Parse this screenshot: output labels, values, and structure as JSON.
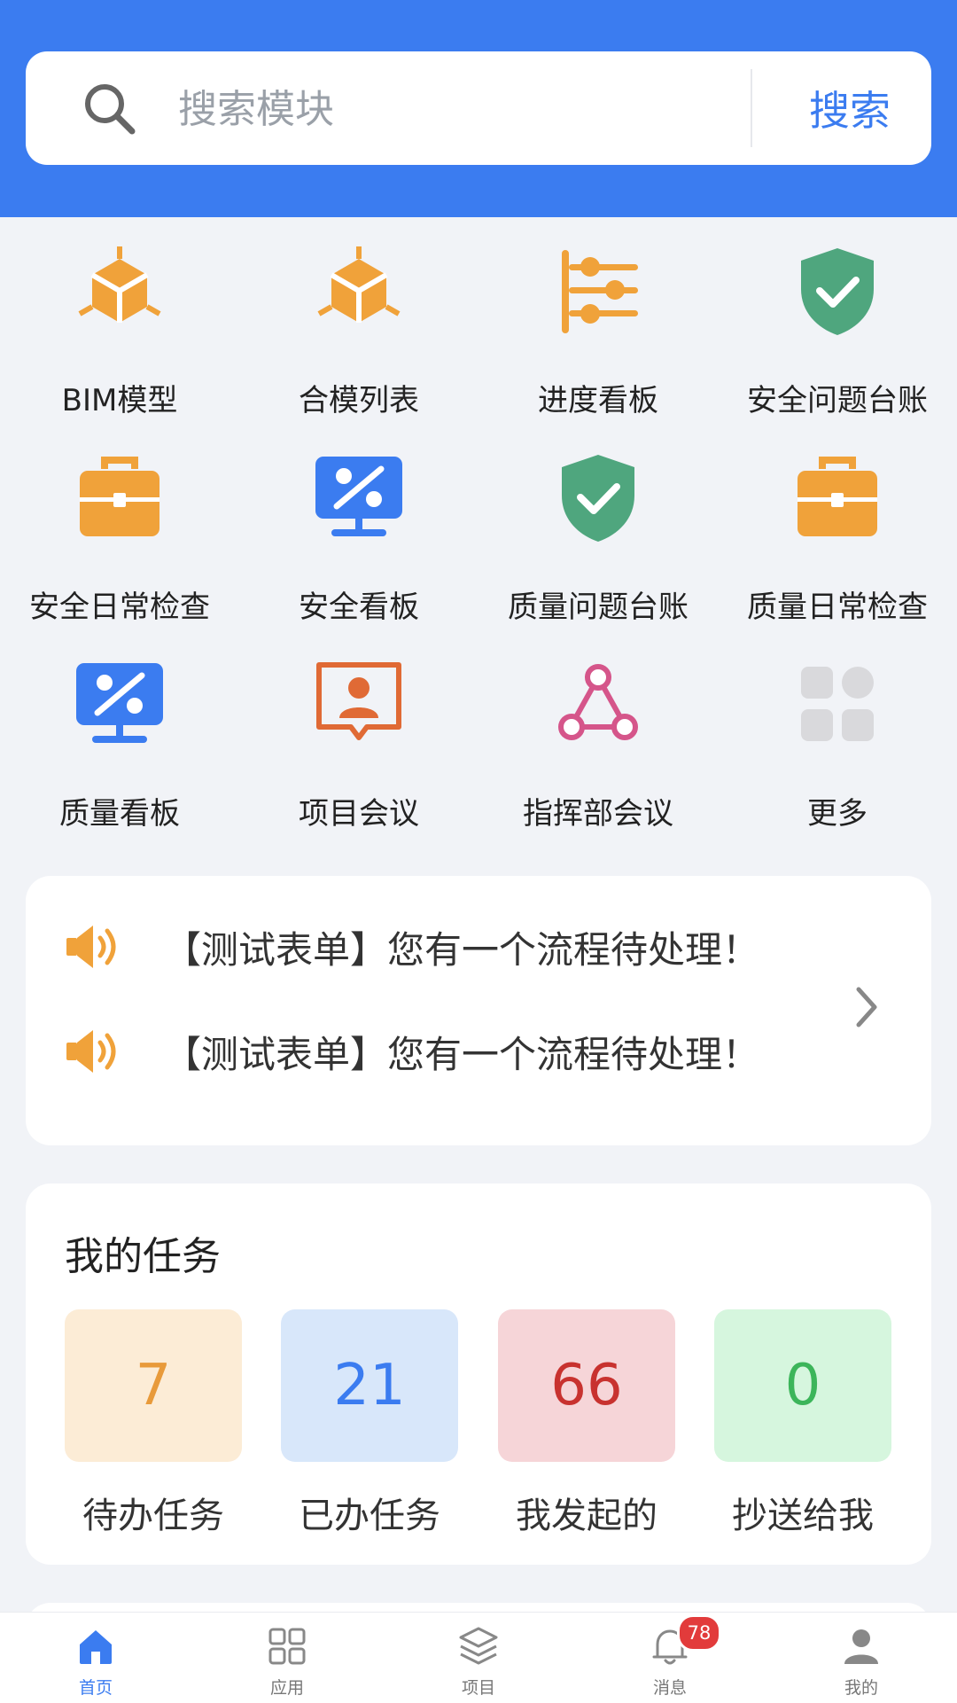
{
  "search": {
    "placeholder": "搜索模块",
    "button_label": "搜索"
  },
  "modules": [
    {
      "label": "BIM模型",
      "icon": "cube-icon"
    },
    {
      "label": "合模列表",
      "icon": "cube-icon"
    },
    {
      "label": "进度看板",
      "icon": "progress-sliders-icon"
    },
    {
      "label": "安全问题台账",
      "icon": "shield-check-icon"
    },
    {
      "label": "安全日常检查",
      "icon": "toolbox-icon"
    },
    {
      "label": "安全看板",
      "icon": "monitor-percent-icon"
    },
    {
      "label": "质量问题台账",
      "icon": "shield-check-icon"
    },
    {
      "label": "质量日常检查",
      "icon": "toolbox-icon"
    },
    {
      "label": "质量看板",
      "icon": "monitor-percent-icon"
    },
    {
      "label": "项目会议",
      "icon": "meeting-person-icon"
    },
    {
      "label": "指挥部会议",
      "icon": "network-icon"
    },
    {
      "label": "更多",
      "icon": "more-grid-icon"
    }
  ],
  "notices": [
    {
      "text": "【测试表单】您有一个流程待处理！"
    },
    {
      "text": "【测试表单】您有一个流程待处理！"
    }
  ],
  "tasks": {
    "title": "我的任务",
    "items": [
      {
        "count": "7",
        "label": "待办任务",
        "color": "#e89a3a",
        "bg": "#fcecd6"
      },
      {
        "count": "21",
        "label": "已办任务",
        "color": "#3b7cf0",
        "bg": "#d8e7fa"
      },
      {
        "count": "66",
        "label": "我发起的",
        "color": "#c8322f",
        "bg": "#f6d5d8"
      },
      {
        "count": "0",
        "label": "抄送给我",
        "color": "#3cb55a",
        "bg": "#d6f6de"
      }
    ]
  },
  "tabbar": {
    "items": [
      {
        "label": "首页",
        "icon": "home-icon",
        "active": true
      },
      {
        "label": "应用",
        "icon": "apps-grid-icon"
      },
      {
        "label": "项目",
        "icon": "layers-icon"
      },
      {
        "label": "消息",
        "icon": "bell-icon",
        "badge": "78"
      },
      {
        "label": "我的",
        "icon": "user-icon"
      }
    ]
  },
  "colors": {
    "brand": "#3b7cf0",
    "orange": "#f0a23a",
    "green": "#4fa67e",
    "pink": "#d5558a"
  }
}
